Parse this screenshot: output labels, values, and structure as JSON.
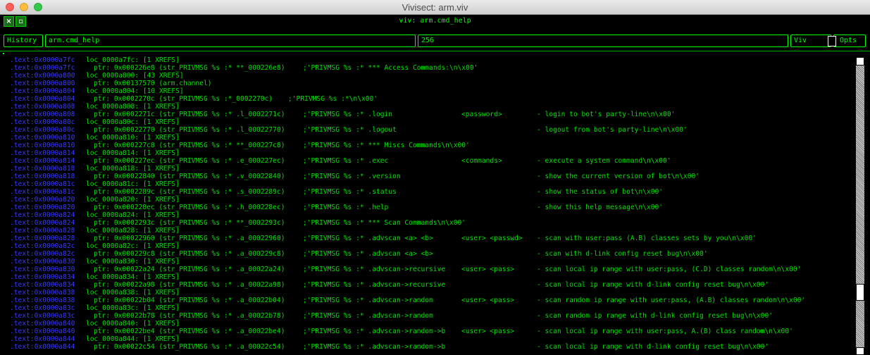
{
  "window": {
    "title": "Vivisect: arm.viv"
  },
  "panel": {
    "title": "viv: arm.cmd_help"
  },
  "controls": {
    "history_label": "History",
    "expression_value": "arm.cmd_help",
    "size_value": "256",
    "viv_label": "Viv",
    "opts_label": "Opts"
  },
  "listing": [
    {
      "addr": ".text:0x0000a7fc",
      "name": "loc_0000a7fc: [1 XREFS]"
    },
    {
      "addr": ".text:0x0000a7fc",
      "ptr": "ptr: 0x000226e8 (str_PRIVMSG %s :* **_000226e8)",
      "cmt": ";'PRIVMSG %s :* *** Access Commands:\\n\\x00'"
    },
    {
      "addr": ".text:0x0000a800",
      "name": "loc_0000a800: [43 XREFS]"
    },
    {
      "addr": ".text:0x0000a800",
      "ptr": "ptr: 0x00137570 (arm.channel)"
    },
    {
      "addr": ".text:0x0000a804",
      "name": "loc_0000a804: [10 XREFS]"
    },
    {
      "addr": ".text:0x0000a804",
      "ptr": "ptr: 0x0002270c (str_PRIVMSG %s :*_0002270c)",
      "cmt2": ";'PRIVMSG %s :*\\n\\x00'"
    },
    {
      "addr": ".text:0x0000a808",
      "name": "loc_0000a808: [1 XREFS]"
    },
    {
      "addr": ".text:0x0000a808",
      "ptr": "ptr: 0x0002271c (str_PRIVMSG %s :* .l_0002271c)",
      "cmt": ";'PRIVMSG %s :* .login",
      "arg": "<password>",
      "desc": "- login to bot's party-line\\n\\x00'"
    },
    {
      "addr": ".text:0x0000a80c",
      "name": "loc_0000a80c: [1 XREFS]"
    },
    {
      "addr": ".text:0x0000a80c",
      "ptr": "ptr: 0x00022770 (str_PRIVMSG %s :* .l_00022770)",
      "cmt": ";'PRIVMSG %s :* .logout",
      "desc": "- logout from bot's party-line\\n\\x00'"
    },
    {
      "addr": ".text:0x0000a810",
      "name": "loc_0000a810: [1 XREFS]"
    },
    {
      "addr": ".text:0x0000a810",
      "ptr": "ptr: 0x000227c8 (str_PRIVMSG %s :* **_000227c8)",
      "cmt": ";'PRIVMSG %s :* *** Miscs Commands\\n\\x00'"
    },
    {
      "addr": ".text:0x0000a814",
      "name": "loc_0000a814: [1 XREFS]"
    },
    {
      "addr": ".text:0x0000a814",
      "ptr": "ptr: 0x000227ec (str_PRIVMSG %s :* .e_000227ec)",
      "cmt": ";'PRIVMSG %s :* .exec",
      "arg": "<commands>",
      "desc": "- execute a system command\\n\\x00'"
    },
    {
      "addr": ".text:0x0000a818",
      "name": "loc_0000a818: [1 XREFS]"
    },
    {
      "addr": ".text:0x0000a818",
      "ptr": "ptr: 0x00022840 (str_PRIVMSG %s :* .v_00022840)",
      "cmt": ";'PRIVMSG %s :* .version",
      "desc": "- show the current version of bot\\n\\x00'"
    },
    {
      "addr": ".text:0x0000a81c",
      "name": "loc_0000a81c: [1 XREFS]"
    },
    {
      "addr": ".text:0x0000a81c",
      "ptr": "ptr: 0x0002289c (str_PRIVMSG %s :* .s_0002289c)",
      "cmt": ";'PRIVMSG %s :* .status",
      "desc": "- show the status of bot\\n\\x00'"
    },
    {
      "addr": ".text:0x0000a820",
      "name": "loc_0000a820: [1 XREFS]"
    },
    {
      "addr": ".text:0x0000a820",
      "ptr": "ptr: 0x000228ec (str_PRIVMSG %s :* .h_000228ec)",
      "cmt": ";'PRIVMSG %s :* .help",
      "desc": "- show this help message\\n\\x00'"
    },
    {
      "addr": ".text:0x0000a824",
      "name": "loc_0000a824: [1 XREFS]"
    },
    {
      "addr": ".text:0x0000a824",
      "ptr": "ptr: 0x0002293c (str_PRIVMSG %s :* **_0002293c)",
      "cmt": ";'PRIVMSG %s :* *** Scan Commands\\n\\x00'"
    },
    {
      "addr": ".text:0x0000a828",
      "name": "loc_0000a828: [1 XREFS]"
    },
    {
      "addr": ".text:0x0000a828",
      "ptr": "ptr: 0x00022960 (str_PRIVMSG %s :* .a_00022960)",
      "cmt": ";'PRIVMSG %s :* .advscan <a> <b>",
      "arg": "<user> <passwd>",
      "desc": "- scan with user:pass (A.B) classes sets by you\\n\\x00'"
    },
    {
      "addr": ".text:0x0000a82c",
      "name": "loc_0000a82c: [1 XREFS]"
    },
    {
      "addr": ".text:0x0000a82c",
      "ptr": "ptr: 0x000229c8 (str_PRIVMSG %s :* .a_000229c8)",
      "cmt": ";'PRIVMSG %s :* .advscan <a> <b>",
      "desc": "- scan with d-link config reset bug\\n\\x00'"
    },
    {
      "addr": ".text:0x0000a830",
      "name": "loc_0000a830: [1 XREFS]"
    },
    {
      "addr": ".text:0x0000a830",
      "ptr": "ptr: 0x00022a24 (str_PRIVMSG %s :* .a_00022a24)",
      "cmt": ";'PRIVMSG %s :* .advscan->recursive",
      "arg": "<user> <pass>",
      "desc": "- scan local ip range with user:pass, (C.D) classes random\\n\\x00'"
    },
    {
      "addr": ".text:0x0000a834",
      "name": "loc_0000a834: [1 XREFS]"
    },
    {
      "addr": ".text:0x0000a834",
      "ptr": "ptr: 0x00022a98 (str_PRIVMSG %s :* .a_00022a98)",
      "cmt": ";'PRIVMSG %s :* .advscan->recursive",
      "desc": "- scan local ip range with d-link config reset bug\\n\\x00'"
    },
    {
      "addr": ".text:0x0000a838",
      "name": "loc_0000a838: [1 XREFS]"
    },
    {
      "addr": ".text:0x0000a838",
      "ptr": "ptr: 0x00022b04 (str_PRIVMSG %s :* .a_00022b04)",
      "cmt": ";'PRIVMSG %s :* .advscan->random",
      "arg": "<user> <pass>",
      "desc": "- scan random ip range with user:pass, (A.B) classes random\\n\\x00'"
    },
    {
      "addr": ".text:0x0000a83c",
      "name": "loc_0000a83c: [1 XREFS]"
    },
    {
      "addr": ".text:0x0000a83c",
      "ptr": "ptr: 0x00022b78 (str_PRIVMSG %s :* .a_00022b78)",
      "cmt": ";'PRIVMSG %s :* .advscan->random",
      "desc": "- scan random ip range with d-link config reset bug\\n\\x00'"
    },
    {
      "addr": ".text:0x0000a840",
      "name": "loc_0000a840: [1 XREFS]"
    },
    {
      "addr": ".text:0x0000a840",
      "ptr": "ptr: 0x00022be4 (str_PRIVMSG %s :* .a_00022be4)",
      "cmt": ";'PRIVMSG %s :* .advscan->random->b",
      "arg": "<user> <pass>",
      "desc": "- scan local ip range with user:pass, A.(B) class random\\n\\x00'"
    },
    {
      "addr": ".text:0x0000a844",
      "name": "loc_0000a844: [1 XREFS]"
    },
    {
      "addr": ".text:0x0000a844",
      "ptr": "ptr: 0x00022c54 (str_PRIVMSG %s :* .a_00022c54)",
      "cmt": ";'PRIVMSG %s :* .advscan->random->b",
      "desc": "- scan local ip range with d-link config reset bug\\n\\x00'"
    }
  ]
}
